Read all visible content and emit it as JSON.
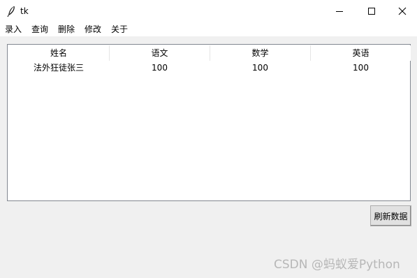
{
  "window": {
    "title": "tk",
    "icon": "feather-icon"
  },
  "menu": {
    "items": [
      "录入",
      "查询",
      "删除",
      "修改",
      "关于"
    ]
  },
  "table": {
    "columns": [
      "姓名",
      "语文",
      "数学",
      "英语"
    ],
    "rows": [
      [
        "法外狂徒张三",
        "100",
        "100",
        "100"
      ]
    ]
  },
  "buttons": {
    "refresh_label": "刷新数据"
  },
  "watermark": {
    "text": "CSDN @蚂蚁爱Python"
  }
}
